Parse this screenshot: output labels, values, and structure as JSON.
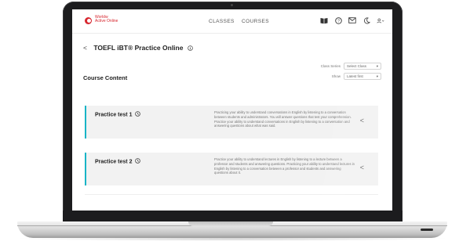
{
  "header": {
    "brand_line1": "Worldw",
    "brand_line2": "Active Online",
    "nav": [
      "CLASSES",
      "COURSES"
    ],
    "icons": [
      "book-icon",
      "help-icon",
      "mail-icon",
      "dark-mode-icon",
      "user-icon"
    ]
  },
  "page": {
    "back_symbol": "<",
    "title": "TOEFL iBT® Practice Online",
    "title_icon": "info-icon"
  },
  "filters": {
    "class_label": "Class Series",
    "class_value": "Select Class",
    "show_label": "Show",
    "show_value": "Latest first"
  },
  "section": {
    "title": "Course Content"
  },
  "cards": [
    {
      "name": "Practice test 1",
      "desc": "Practicing your ability to understand conversations in English by listening to a conversation between students and administrators. You will answer questions that test your comprehension. Practice your ability to understand conversations in English by listening to a conversation and answering questions about what was said.",
      "chev": "<"
    },
    {
      "name": "Practice test 2",
      "desc": "Practice your ability to understand lectures in English by listening to a lecture between a professor and students and answering questions. Practicing your ability to understand lectures in English by listening to a conversation between a professor and students and answering questions about it.",
      "chev": "<"
    }
  ]
}
